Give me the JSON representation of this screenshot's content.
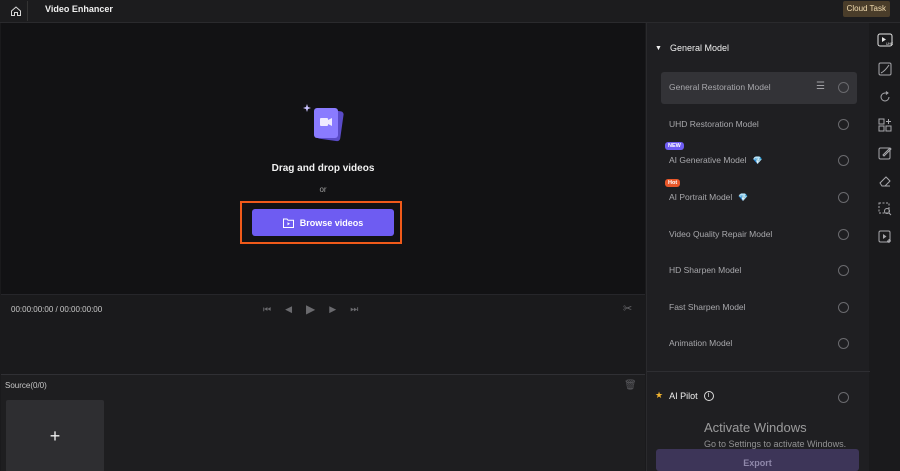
{
  "header": {
    "title": "Video Enhancer",
    "cloud_task": "Cloud Task"
  },
  "preview": {
    "drag_text": "Drag and drop videos",
    "or_text": "or",
    "browse_label": "Browse videos"
  },
  "playback": {
    "timecode": "00:00:00:00 / 00:00:00:00"
  },
  "source": {
    "label": "Source(0/0)",
    "add_symbol": "+"
  },
  "models": {
    "section_title": "General Model",
    "items": [
      {
        "label": "General Restoration Model",
        "selected": true
      },
      {
        "label": "UHD Restoration Model"
      },
      {
        "label": "AI Generative Model",
        "badge": "NEW",
        "premium": true
      },
      {
        "label": "AI Portrait Model",
        "badge": "Hot",
        "premium": true
      },
      {
        "label": "Video Quality Repair Model"
      },
      {
        "label": "HD Sharpen Model"
      },
      {
        "label": "Fast Sharpen Model"
      },
      {
        "label": "Animation Model"
      }
    ]
  },
  "ai_pilot": {
    "label": "AI Pilot"
  },
  "watermark": {
    "line1": "Activate Windows",
    "line2": "Go to Settings to activate Windows."
  },
  "export_label": "Export",
  "toolbar": {
    "icons": [
      "video-uhd-icon",
      "curve-icon",
      "rotate-refresh-icon",
      "grid-plus-icon",
      "edit-frame-icon",
      "eraser-icon",
      "select-area-icon",
      "play-plus-icon"
    ]
  },
  "colors": {
    "accent": "#6e5cf2",
    "highlight_outline": "#f05a1a",
    "badge_new": "#6e5cf2",
    "badge_hot": "#e8572a"
  }
}
